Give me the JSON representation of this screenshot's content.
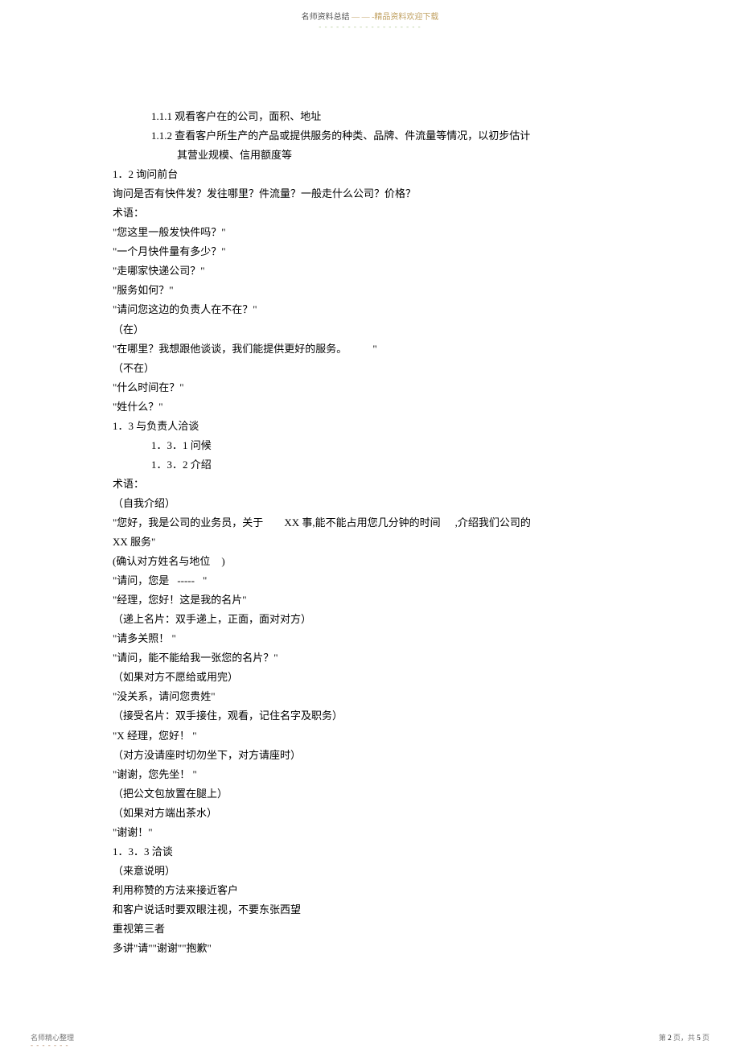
{
  "header": {
    "left": "名师资料总结 ",
    "right": "— — -精品资料欢迎下载",
    "dashes": "- - - - - - - - - - - - - - - - - -"
  },
  "body": {
    "l1": "1.1.1 观看客户在的公司，面积、地址",
    "l2": "1.1.2 查看客户所生产的产品或提供服务的种类、品牌、件流量等情况，以初步估计",
    "l3": "其营业规模、信用额度等",
    "l4": "1．2 询问前台",
    "l5": "询问是否有快件发？发往哪里？件流量？一般走什么公司？价格？",
    "l6": "术语：",
    "l7": "\"您这里一般发快件吗？\"",
    "l8": "\"一个月快件量有多少？\"",
    "l9": "\"走哪家快递公司？\"",
    "l10": "\"服务如何？\"",
    "l11": "\"请问您这边的负责人在不在？\"",
    "l12": "（在）",
    "l13_a": "\"在哪里？我想跟他谈谈，我们能提供更好的服务。",
    "l13_b": "\"",
    "l14": "（不在）",
    "l15": "\"什么时间在？\"",
    "l16": "\"姓什么？\"",
    "l17": "1．3 与负责人洽谈",
    "l18": "1．3．1 问候",
    "l19": "1．3．2 介绍",
    "l20": "术语：",
    "l21": "（自我介绍）",
    "l22_a": "\"您好，我是公司的业务员，关于",
    "l22_b": "XX 事,能不能占用您几分钟的时间",
    "l22_c": ",介绍我们公司的",
    "l23": "XX 服务\"",
    "l24_a": "(确认对方姓名与地位",
    "l24_b": ")",
    "l25_a": "\"请问，您是",
    "l25_b": "-----",
    "l25_c": "\"",
    "l26": "\"经理，您好！这是我的名片\"",
    "l27": "（递上名片：双手递上，正面，面对对方）",
    "l28": "\"请多关照！ \"",
    "l29": "\"请问，能不能给我一张您的名片？\"",
    "l30": "（如果对方不愿给或用完）",
    "l31": "\"没关系，请问您贵姓\"",
    "l32": "（接受名片：双手接住，观看，记住名字及职务）",
    "l33": "\"X 经理，您好！ \"",
    "l34": "（对方没请座时切勿坐下，对方请座时）",
    "l35": "\"谢谢，您先坐！ \"",
    "l36": "（把公文包放置在腿上）",
    "l37": "（如果对方端出茶水）",
    "l38": "\"谢谢！\"",
    "l39": "1．3．3 洽谈",
    "l40": "（来意说明）",
    "l41": "利用称赞的方法来接近客户",
    "l42": "和客户说话时要双眼注视，不要东张西望",
    "l43": "重视第三者",
    "l44": "多讲\"请\"\"谢谢\"\"抱歉\""
  },
  "footer": {
    "left": "名师精心整理",
    "left_dashes": "- - - - - - -",
    "right_prefix": "第 ",
    "page_current": "2",
    "right_mid": " 页，共 ",
    "page_total": "5",
    "right_suffix": " 页"
  }
}
